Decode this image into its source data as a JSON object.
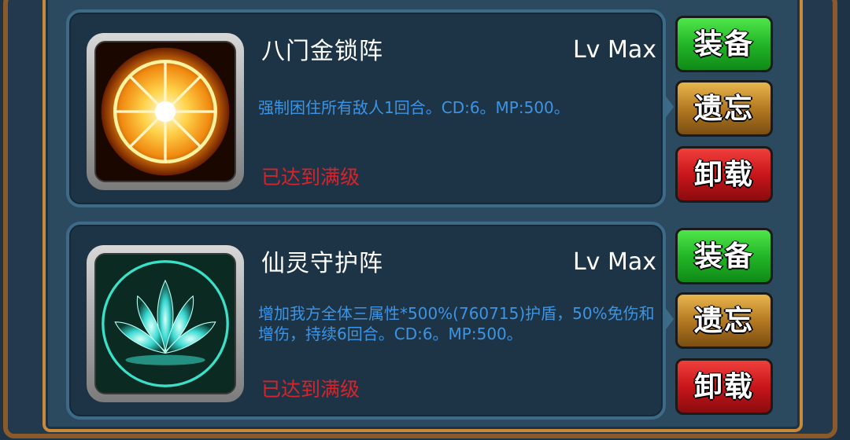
{
  "skills": [
    {
      "name": "八门金锁阵",
      "level": "Lv Max",
      "description": "强制困住所有敌人1回合。CD:6。MP:500。",
      "status": "已达到满级",
      "icon": "golden-sun-wheel-icon",
      "buttons": {
        "equip": "装备",
        "forget": "遗忘",
        "unload": "卸载"
      }
    },
    {
      "name": "仙灵守护阵",
      "level": "Lv Max",
      "description": "增加我方全体三属性*500%(760715)护盾，50%免伤和增伤，持续6回合。CD:6。MP:500。",
      "status": "已达到满级",
      "icon": "cyan-lotus-icon",
      "buttons": {
        "equip": "装备",
        "forget": "遗忘",
        "unload": "卸载"
      }
    }
  ],
  "colors": {
    "description": "#3d94e4",
    "status": "#d8232a",
    "equip": "#23b629",
    "forget": "#b57a22",
    "unload": "#c8161b"
  }
}
